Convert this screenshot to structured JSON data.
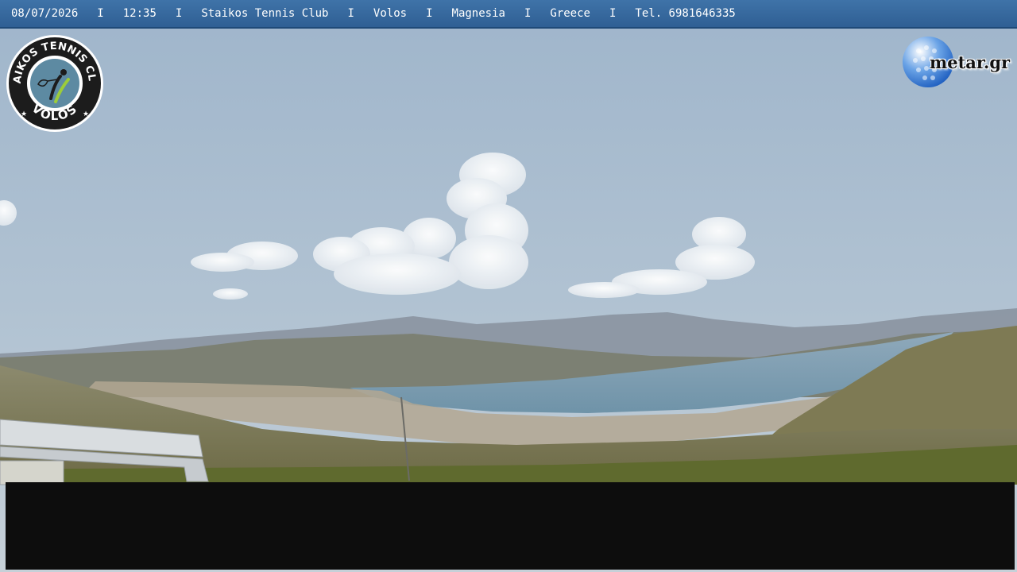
{
  "overlay": {
    "date": "08/07/2026",
    "time": "12:35",
    "club": "Staikos Tennis Club",
    "city": "Volos",
    "region": "Magnesia",
    "country": "Greece",
    "phone": "Tel. 6981646335",
    "separator": "I"
  },
  "logos": {
    "club_logo_text_top": "STAIKOS TENNIS CLUB",
    "club_logo_text_bottom": "VOLOS",
    "brand_logo_text": "metar.gr"
  },
  "colors": {
    "bar": "#3568a0",
    "sky": "#a8bccd",
    "sea": "#7f9eb2",
    "panel": "#0d0d0d"
  }
}
